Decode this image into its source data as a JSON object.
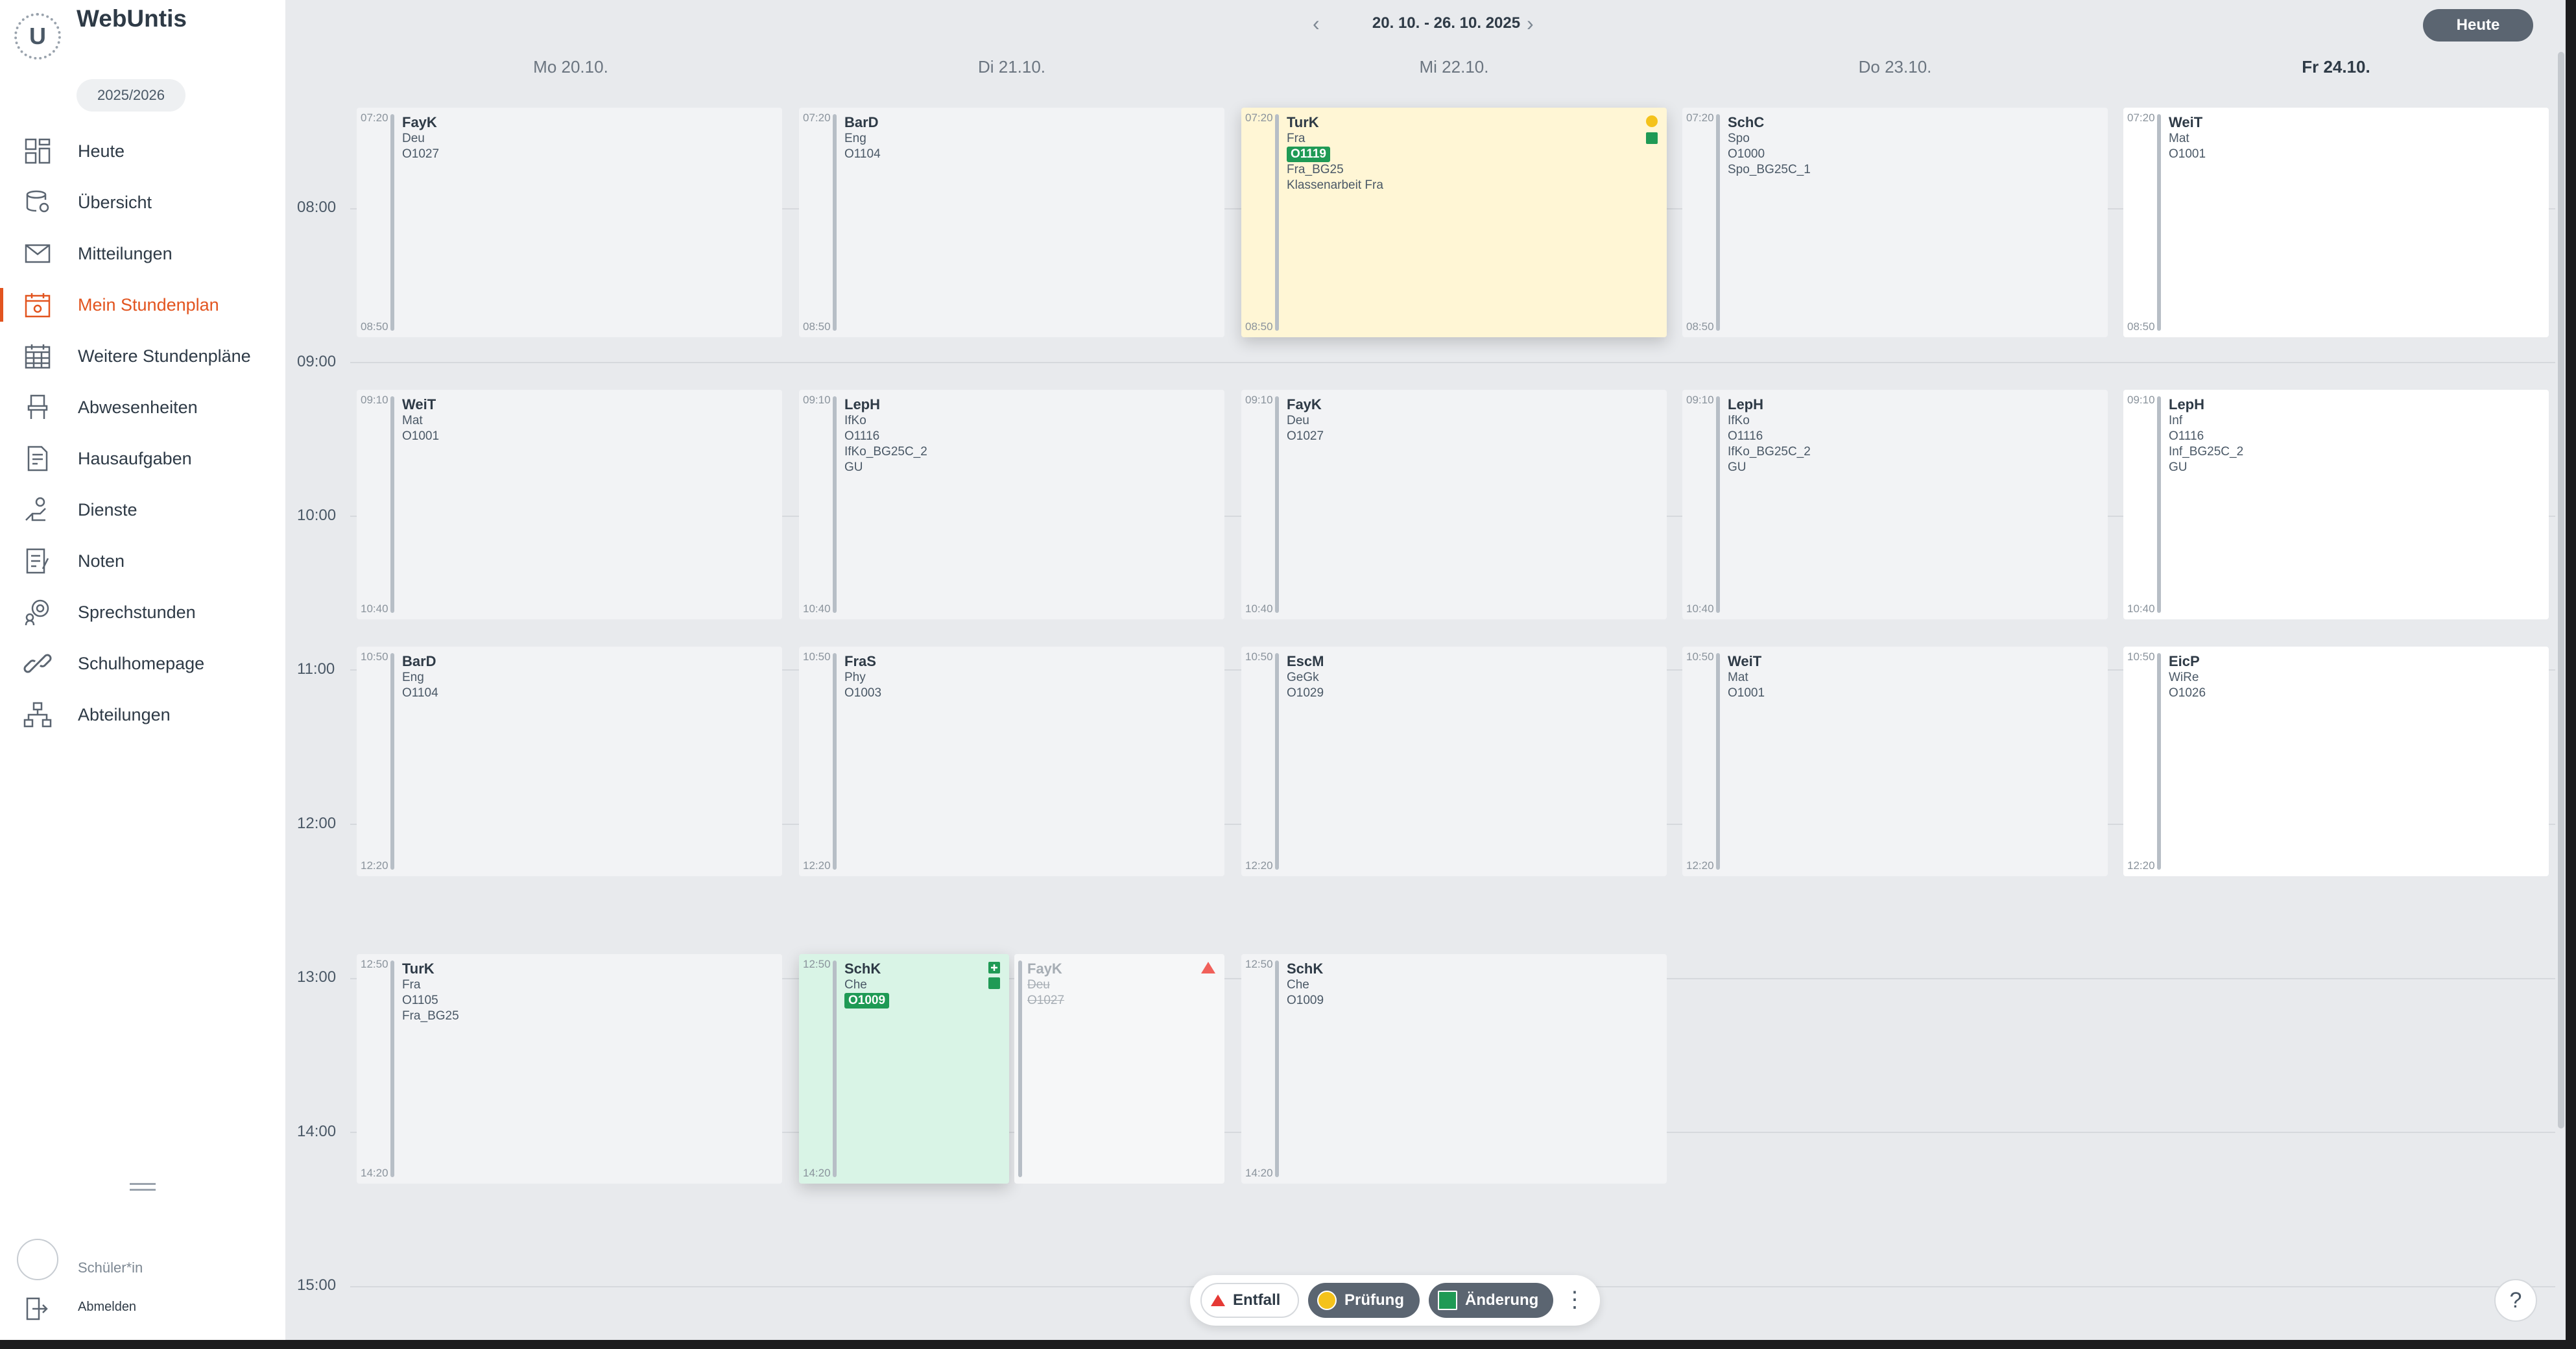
{
  "app": {
    "title": "WebUntis",
    "logo_letter": "U",
    "school_year": "2025/2026"
  },
  "nav": [
    {
      "label": "Heute",
      "icon": "dashboard-icon"
    },
    {
      "label": "Übersicht",
      "icon": "overview-icon"
    },
    {
      "label": "Mitteilungen",
      "icon": "mail-icon"
    },
    {
      "label": "Mein Stundenplan",
      "icon": "calendar-icon",
      "active": true
    },
    {
      "label": "Weitere Stundenpläne",
      "icon": "calendar-grid-icon"
    },
    {
      "label": "Abwesenheiten",
      "icon": "chair-icon"
    },
    {
      "label": "Hausaufgaben",
      "icon": "homework-icon"
    },
    {
      "label": "Dienste",
      "icon": "duties-icon"
    },
    {
      "label": "Noten",
      "icon": "grades-icon"
    },
    {
      "label": "Sprechstunden",
      "icon": "consultation-icon"
    },
    {
      "label": "Schulhomepage",
      "icon": "link-icon"
    },
    {
      "label": "Abteilungen",
      "icon": "departments-icon"
    }
  ],
  "user": {
    "role": "Schüler*in",
    "logout": "Abmelden"
  },
  "header": {
    "range": "20. 10. - 26. 10. 2025",
    "today_button": "Heute"
  },
  "days": [
    "Mo 20.10.",
    "Di 21.10.",
    "Mi 22.10.",
    "Do 23.10.",
    "Fr 24.10."
  ],
  "times": [
    "08:00",
    "09:00",
    "10:00",
    "11:00",
    "12:00",
    "13:00",
    "14:00",
    "15:00"
  ],
  "lessons": {
    "mo1": {
      "start": "07:20",
      "end": "08:50",
      "teacher": "FayK",
      "lines": [
        "Deu",
        "O1027"
      ]
    },
    "di1": {
      "start": "07:20",
      "end": "08:50",
      "teacher": "BarD",
      "lines": [
        "Eng",
        "O1104"
      ]
    },
    "mi1": {
      "start": "07:20",
      "end": "08:50",
      "teacher": "TurK",
      "lines": [
        "Fra"
      ],
      "room_changed": "O1119",
      "extra": [
        "Fra_BG25",
        "Klassenarbeit Fra"
      ]
    },
    "do1": {
      "start": "07:20",
      "end": "08:50",
      "teacher": "SchC",
      "lines": [
        "Spo",
        "O1000",
        "Spo_BG25C_1"
      ]
    },
    "fr1": {
      "start": "07:20",
      "end": "08:50",
      "teacher": "WeiT",
      "lines": [
        "Mat",
        "O1001"
      ]
    },
    "mo2": {
      "start": "09:10",
      "end": "10:40",
      "teacher": "WeiT",
      "lines": [
        "Mat",
        "O1001"
      ]
    },
    "di2": {
      "start": "09:10",
      "end": "10:40",
      "teacher": "LepH",
      "lines": [
        "IfKo",
        "O1116",
        "IfKo_BG25C_2",
        "GU"
      ]
    },
    "mi2": {
      "start": "09:10",
      "end": "10:40",
      "teacher": "FayK",
      "lines": [
        "Deu",
        "O1027"
      ]
    },
    "do2": {
      "start": "09:10",
      "end": "10:40",
      "teacher": "LepH",
      "lines": [
        "IfKo",
        "O1116",
        "IfKo_BG25C_2",
        "GU"
      ]
    },
    "fr2": {
      "start": "09:10",
      "end": "10:40",
      "teacher": "LepH",
      "lines": [
        "Inf",
        "O1116",
        "Inf_BG25C_2",
        "GU"
      ]
    },
    "mo3": {
      "start": "10:50",
      "end": "12:20",
      "teacher": "BarD",
      "lines": [
        "Eng",
        "O1104"
      ]
    },
    "di3": {
      "start": "10:50",
      "end": "12:20",
      "teacher": "FraS",
      "lines": [
        "Phy",
        "O1003"
      ]
    },
    "mi3": {
      "start": "10:50",
      "end": "12:20",
      "teacher": "EscM",
      "lines": [
        "GeGk",
        "O1029"
      ]
    },
    "do3": {
      "start": "10:50",
      "end": "12:20",
      "teacher": "WeiT",
      "lines": [
        "Mat",
        "O1001"
      ]
    },
    "fr3": {
      "start": "10:50",
      "end": "12:20",
      "teacher": "EicP",
      "lines": [
        "WiRe",
        "O1026"
      ]
    },
    "mo4": {
      "start": "12:50",
      "end": "14:20",
      "teacher": "TurK",
      "lines": [
        "Fra",
        "O1105",
        "Fra_BG25"
      ]
    },
    "di4a": {
      "start": "12:50",
      "end": "14:20",
      "teacher": "SchK",
      "lines": [
        "Che"
      ],
      "room_changed": "O1009"
    },
    "di4b": {
      "teacher": "FayK",
      "lines": [
        "Deu",
        "O1027"
      ]
    },
    "mi4": {
      "start": "12:50",
      "end": "14:20",
      "teacher": "SchK",
      "lines": [
        "Che",
        "O1009"
      ]
    }
  },
  "legend": {
    "cancelled": "Entfall",
    "exam": "Prüfung",
    "change": "Änderung"
  },
  "colors": {
    "accent": "#e2541f",
    "exam": "#f4c21b",
    "change": "#1f9a55",
    "cancelled": "#f0605a"
  }
}
